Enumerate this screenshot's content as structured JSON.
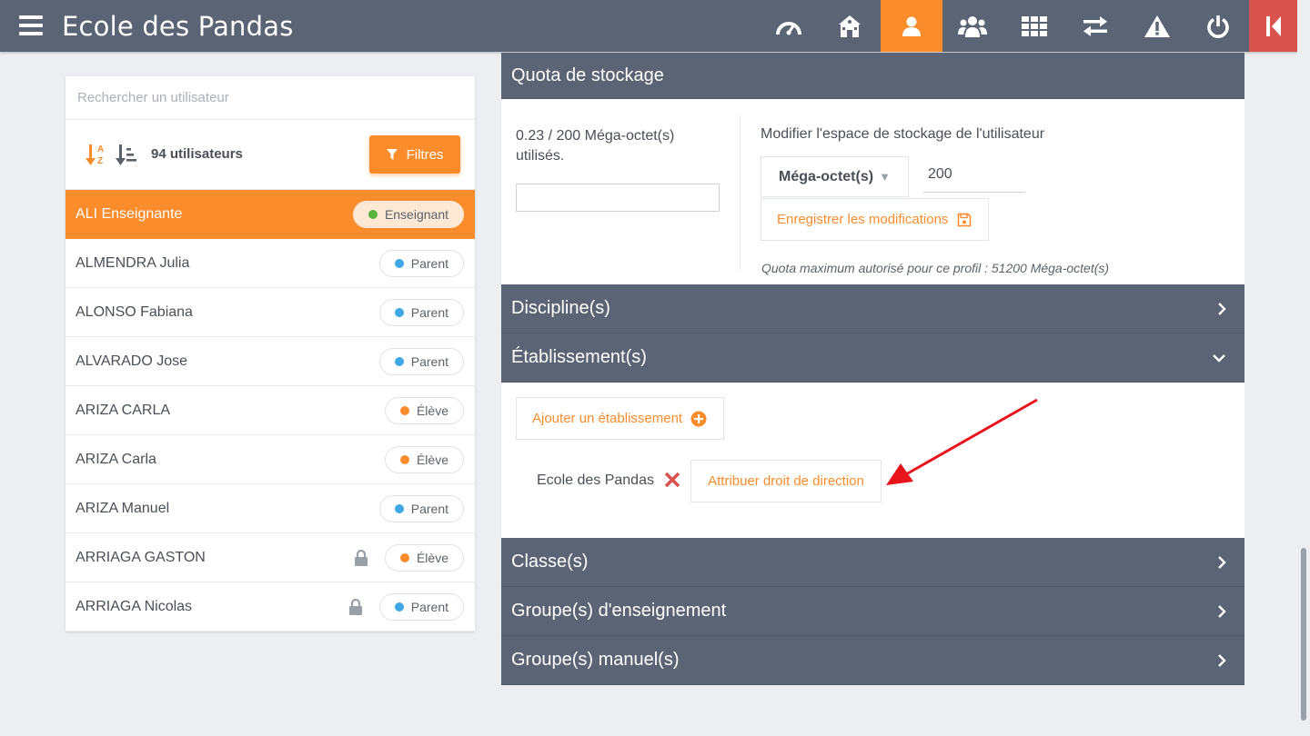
{
  "app": {
    "title": "Ecole des Pandas"
  },
  "nav": {
    "icons": [
      "dashboard-icon",
      "school-icon",
      "user-icon",
      "users-group-icon",
      "grid-icon",
      "exchange-icon",
      "warning-icon",
      "power-icon",
      "exit-icon"
    ],
    "active": "user-icon",
    "accent_color": "#fb8c2c",
    "exit_color": "#d9534f",
    "bar_color": "#5a6475"
  },
  "search": {
    "placeholder": "Rechercher un utilisateur",
    "value": ""
  },
  "toolbar": {
    "user_count": "94 utilisateurs",
    "filter_label": "Filtres"
  },
  "users": [
    {
      "name": "ALI Enseignante",
      "role": "Enseignant",
      "dot": "#59b43b",
      "selected": true,
      "locked": false
    },
    {
      "name": "ALMENDRA Julia",
      "role": "Parent",
      "dot": "#3ea8e5",
      "selected": false,
      "locked": false
    },
    {
      "name": "ALONSO Fabiana",
      "role": "Parent",
      "dot": "#3ea8e5",
      "selected": false,
      "locked": false
    },
    {
      "name": "ALVARADO Jose",
      "role": "Parent",
      "dot": "#3ea8e5",
      "selected": false,
      "locked": false
    },
    {
      "name": "ARIZA CARLA",
      "role": "Élève",
      "dot": "#fb8c2c",
      "selected": false,
      "locked": false
    },
    {
      "name": "ARIZA Carla",
      "role": "Élève",
      "dot": "#fb8c2c",
      "selected": false,
      "locked": false
    },
    {
      "name": "ARIZA Manuel",
      "role": "Parent",
      "dot": "#3ea8e5",
      "selected": false,
      "locked": false
    },
    {
      "name": "ARRIAGA GASTON",
      "role": "Élève",
      "dot": "#fb8c2c",
      "selected": false,
      "locked": true
    },
    {
      "name": "ARRIAGA Nicolas",
      "role": "Parent",
      "dot": "#3ea8e5",
      "selected": false,
      "locked": true
    }
  ],
  "quota": {
    "header": "Quota de stockage",
    "used_text": "0.23 / 200 Méga-octet(s) utilisés.",
    "modify_label": "Modifier l'espace de stockage de l'utilisateur",
    "unit": "Méga-octet(s)",
    "value": "200",
    "save_label": "Enregistrer les modifications",
    "note": "Quota maximum autorisé pour ce profil : 51200 Méga-octet(s)"
  },
  "sections": {
    "discipline": "Discipline(s)",
    "etablissement": "Établissement(s)",
    "classe": "Classe(s)",
    "groupe_enseignement": "Groupe(s) d'enseignement",
    "groupe_manuel": "Groupe(s) manuel(s)"
  },
  "etablissement": {
    "add_label": "Ajouter un établissement",
    "school_name": "Ecole des Pandas",
    "direction_label": "Attribuer droit de direction"
  }
}
